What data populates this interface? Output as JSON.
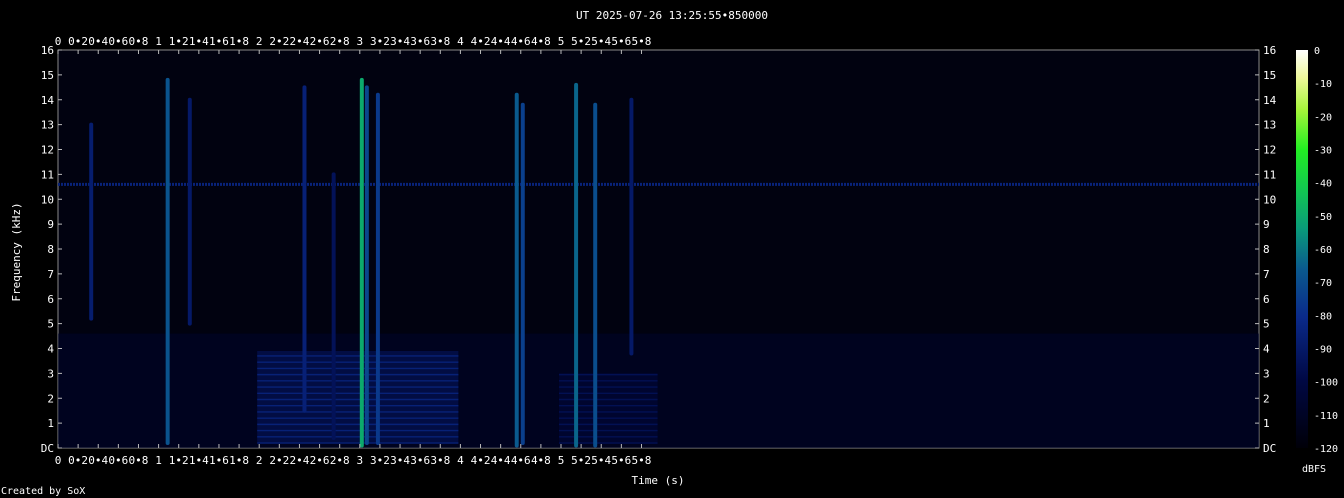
{
  "chart_data": {
    "type": "heatmap",
    "title": "UT 2025-07-26 13:25:55•850000",
    "xlabel": "Time (s)",
    "ylabel": "Frequency (kHz)",
    "footer": "Created by SoX",
    "xlim": [
      0,
      5.96
    ],
    "ylim": [
      0,
      16
    ],
    "x_ticks": [
      "0",
      "0•2",
      "0•4",
      "0•6",
      "0•8",
      "1",
      "1•2",
      "1•4",
      "1•6",
      "1•8",
      "2",
      "2•2",
      "2•4",
      "2•6",
      "2•8",
      "3",
      "3•2",
      "3•4",
      "3•6",
      "3•8",
      "4",
      "4•2",
      "4•4",
      "4•6",
      "4•8",
      "5",
      "5•2",
      "5•4",
      "5•6",
      "5•8"
    ],
    "y_ticks": [
      "DC",
      "1",
      "2",
      "3",
      "4",
      "5",
      "6",
      "7",
      "8",
      "9",
      "10",
      "11",
      "12",
      "13",
      "14",
      "15",
      "16"
    ],
    "colorbar": {
      "label": "dBFS",
      "ticks": [
        "0",
        "-10",
        "-20",
        "-30",
        "-40",
        "-50",
        "-60",
        "-70",
        "-80",
        "-90",
        "-100",
        "-110",
        "-120"
      ],
      "range": [
        -120,
        0
      ]
    },
    "background_band": {
      "freq_khz": 10.6,
      "level_dbfs": -85
    },
    "noise_floor_dbfs": -108,
    "transients": [
      {
        "t": 0.33,
        "f_low": 5.2,
        "f_high": 13.0,
        "level_dbfs": -88
      },
      {
        "t": 1.09,
        "f_low": 0.2,
        "f_high": 14.8,
        "level_dbfs": -68
      },
      {
        "t": 1.31,
        "f_low": 5.0,
        "f_high": 14.0,
        "level_dbfs": -90
      },
      {
        "t": 2.45,
        "f_low": 1.5,
        "f_high": 14.5,
        "level_dbfs": -86
      },
      {
        "t": 2.74,
        "f_low": 0.4,
        "f_high": 11.0,
        "level_dbfs": -94
      },
      {
        "t": 3.02,
        "f_low": 0.1,
        "f_high": 14.8,
        "level_dbfs": -50
      },
      {
        "t": 3.07,
        "f_low": 0.2,
        "f_high": 14.5,
        "level_dbfs": -72
      },
      {
        "t": 3.18,
        "f_low": 0.2,
        "f_high": 14.2,
        "level_dbfs": -76
      },
      {
        "t": 4.56,
        "f_low": 0.1,
        "f_high": 14.2,
        "level_dbfs": -66
      },
      {
        "t": 4.62,
        "f_low": 0.2,
        "f_high": 13.8,
        "level_dbfs": -74
      },
      {
        "t": 5.15,
        "f_low": 0.1,
        "f_high": 14.6,
        "level_dbfs": -64
      },
      {
        "t": 5.34,
        "f_low": 0.1,
        "f_high": 13.8,
        "level_dbfs": -70
      },
      {
        "t": 5.7,
        "f_low": 3.8,
        "f_high": 14.0,
        "level_dbfs": -90
      }
    ],
    "harmonic_blocks": [
      {
        "t_start": 1.98,
        "t_end": 3.98,
        "f_low": 0.2,
        "f_high": 3.9,
        "level_dbfs": -84,
        "line_spacing_khz": 0.25
      },
      {
        "t_start": 4.98,
        "t_end": 5.96,
        "f_low": 0.2,
        "f_high": 3.0,
        "level_dbfs": -94,
        "line_spacing_khz": 0.25
      }
    ]
  }
}
